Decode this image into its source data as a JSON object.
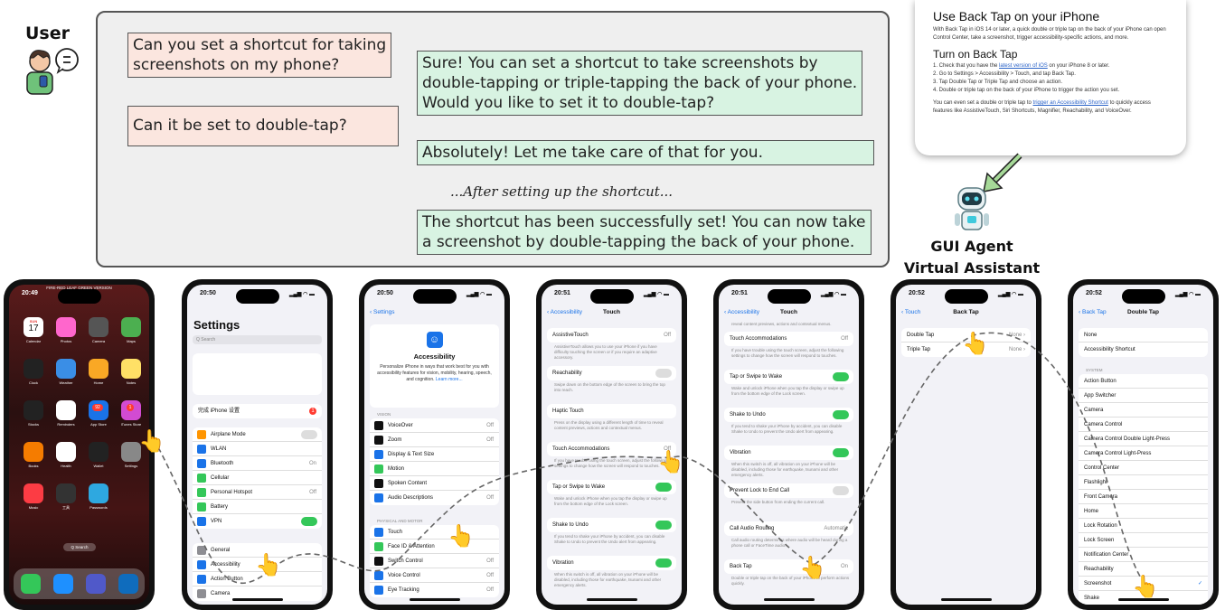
{
  "user_label": "User",
  "agent_label_1": "GUI Agent",
  "agent_label_2": "Virtual Assistant",
  "conversation": {
    "user_1": [
      "Can you set a shortcut for taking",
      "screenshots on my phone?"
    ],
    "assistant_1": [
      "Sure! You can set a shortcut to take screenshots by",
      "double-tapping or triple-tapping the back of your phone.",
      "Would you like to set it to double-tap?"
    ],
    "user_2": "Can it be set to double-tap?",
    "assistant_2": "Absolutely! Let me take care of that for you.",
    "separator": "...After setting up the shortcut...",
    "assistant_3": [
      "The shortcut has been successfully set! You can now take",
      "a screenshot by double-tapping the back of your phone."
    ]
  },
  "help_article": {
    "title": "Use Back Tap on your iPhone",
    "intro": "With Back Tap in iOS 14 or later, a quick double or triple tap on the back of your iPhone can open Control Center, take a screenshot, trigger accessibility-specific actions, and more.",
    "subtitle": "Turn on Back Tap",
    "step1_a": "1. Check that you have the ",
    "step1_link": "latest version of iOS",
    "step1_b": " on your iPhone 8 or later.",
    "step2": "2. Go to Settings > Accessibility > Touch, and tap Back Tap.",
    "step3": "3. Tap Double Tap or Triple Tap and choose an action.",
    "step4": "4. Double or triple tap on the back of your iPhone to trigger the action you set.",
    "outro_a": "You can even set a double or triple tap to ",
    "outro_link": "trigger an Accessibility Shortcut",
    "outro_b": " to quickly access features like AssistiveTouch, Siri Shortcuts, Magnifier, Reachability, and VoiceOver."
  },
  "phone1": {
    "time": "20:49",
    "banner": "FIRE-RED LEAF GREEN VERSION",
    "date_day": "SUN",
    "date_num": "17",
    "apps": [
      "Calendar",
      "Photos",
      "Camera",
      "Maps",
      "Clock",
      "Weather",
      "Home",
      "Notes",
      "Stocks",
      "Reminders",
      "App Store",
      "iTunes Store",
      "Books",
      "Health",
      "Wallet",
      "Settings",
      "Music",
      "工具",
      "Passwords"
    ],
    "settings_badge": "1",
    "appstore_badge": "92",
    "search": "Q Search"
  },
  "phone2": {
    "time": "20:50",
    "title": "Settings",
    "search": "Q Search",
    "complete": "完成 iPhone 设置",
    "badge": "1",
    "rows": [
      "Airplane Mode",
      "WLAN",
      "Bluetooth",
      "Cellular",
      "Personal Hotspot",
      "Battery",
      "VPN"
    ],
    "bluetooth_val": "On",
    "hotspot_val": "Off",
    "rows2": [
      "General",
      "Accessibility",
      "Action Button",
      "Camera"
    ]
  },
  "phone3": {
    "time": "20:50",
    "back": "Settings",
    "title": "Accessibility",
    "desc": "Personalize iPhone in ways that work best for you with accessibility features for vision, mobility, hearing, speech, and cognition.",
    "learn_more": "Learn more...",
    "vision_header": "VISION",
    "vision_rows": [
      "VoiceOver",
      "Zoom",
      "Display & Text Size",
      "Motion",
      "Spoken Content",
      "Audio Descriptions"
    ],
    "off": "Off",
    "motor_header": "PHYSICAL AND MOTOR",
    "motor_rows": [
      "Touch",
      "Face ID & Attention",
      "Switch Control",
      "Voice Control",
      "Eye Tracking"
    ]
  },
  "phone4": {
    "time": "20:51",
    "back": "Accessibility",
    "title": "Touch",
    "rows": [
      "AssistiveTouch",
      "Reachability",
      "Haptic Touch",
      "Touch Accommodations",
      "Tap or Swipe to Wake",
      "Shake to Undo",
      "Vibration"
    ],
    "off": "Off",
    "desc_assist": "AssistiveTouch allows you to use your iPhone if you have difficulty touching the screen or if you require an adaptive accessory.",
    "desc_reach": "Swipe down on the bottom edge of the screen to bring the top into reach.",
    "desc_haptic": "Press on the display using a different length of time to reveal content previews, actions and contextual menus.",
    "desc_accom": "If you have trouble using the touch screen, adjust the following settings to change how the screen will respond to touches.",
    "desc_wake": "Wake and unlock iPhone when you tap the display or swipe up from the bottom edge of the Lock screen.",
    "desc_shake": "If you tend to shake your iPhone by accident, you can disable Shake to Undo to prevent the Undo alert from appearing.",
    "desc_vib": "When this switch is off, all vibration on your iPhone will be disabled, including those for earthquake, tsunami and other emergency alerts."
  },
  "phone5": {
    "time": "20:51",
    "back": "Accessibility",
    "title": "Touch",
    "top_desc": "reveal content previews, actions and contextual menus.",
    "rows": [
      "Touch Accommodations",
      "Tap or Swipe to Wake",
      "Shake to Undo",
      "Vibration",
      "Prevent Lock to End Call",
      "Call Audio Routing",
      "Back Tap"
    ],
    "off": "Off",
    "routing_val": "Automatic",
    "backtap_val": "On",
    "desc_accom": "If you have trouble using the touch screen, adjust the following settings to change how the screen will respond to touches.",
    "desc_wake": "Wake and unlock iPhone when you tap the display or swipe up from the bottom edge of the Lock screen.",
    "desc_shake": "If you tend to shake your iPhone by accident, you can disable Shake to Undo to prevent the Undo alert from appearing.",
    "desc_vib": "When this switch is off, all vibration on your iPhone will be disabled, including those for earthquake, tsunami and other emergency alerts.",
    "desc_lock": "Prevent the side button from ending the current call.",
    "desc_route": "Call audio routing determines where audio will be heard during a phone call or FaceTime audio.",
    "desc_back": "Double or triple tap on the back of your iPhone to perform actions quickly."
  },
  "phone6": {
    "time": "20:52",
    "back": "Touch",
    "title": "Back Tap",
    "rows": [
      "Double Tap",
      "Triple Tap"
    ],
    "val": "None"
  },
  "phone7": {
    "time": "20:52",
    "back": "Back Tap",
    "title": "Double Tap",
    "top_rows": [
      "None",
      "Accessibility Shortcut"
    ],
    "system_header": "SYSTEM",
    "rows": [
      "Action Button",
      "App Switcher",
      "Camera",
      "Camera Control",
      "Camera Control Double Light-Press",
      "Camera Control Light-Press",
      "Control Center",
      "Flashlight",
      "Front Camera",
      "Home",
      "Lock Rotation",
      "Lock Screen",
      "Notification Center",
      "Reachability",
      "Screenshot",
      "Shake"
    ],
    "check": "✓"
  }
}
